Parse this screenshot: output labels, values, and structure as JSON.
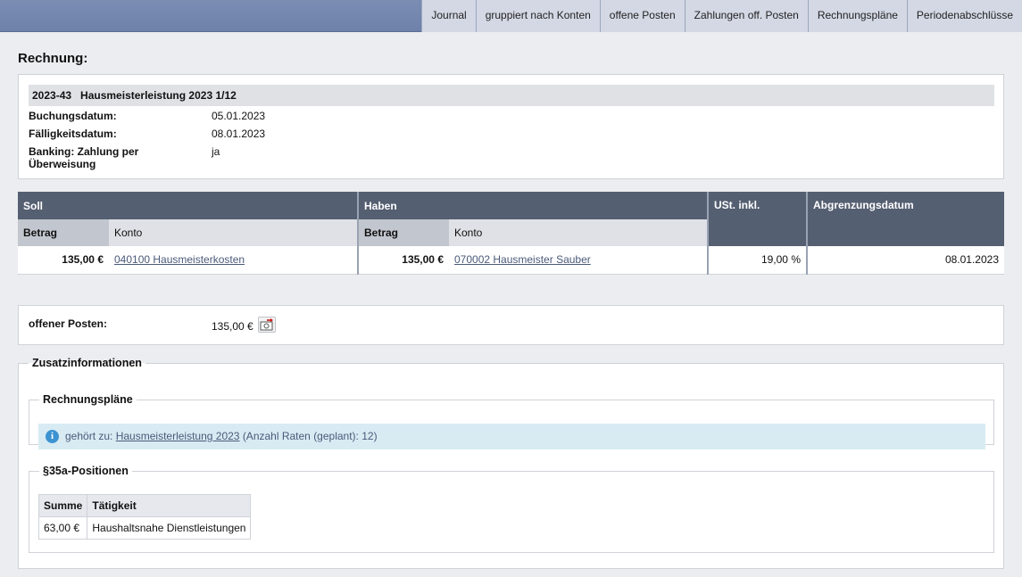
{
  "nav": {
    "tabs": [
      "Journal",
      "gruppiert nach Konten",
      "offene Posten",
      "Zahlungen off. Posten",
      "Rechnungspläne",
      "Periodenabschlüsse"
    ]
  },
  "page": {
    "title": "Rechnung:"
  },
  "invoice": {
    "number": "2023-43",
    "name": "Hausmeisterleistung 2023 1/12",
    "booking_date_label": "Buchungsdatum:",
    "booking_date": "05.01.2023",
    "due_date_label": "Fälligkeitsdatum:",
    "due_date": "08.01.2023",
    "banking_label": "Banking: Zahlung per Überweisung",
    "banking_value": "ja"
  },
  "booking": {
    "soll_header": "Soll",
    "haben_header": "Haben",
    "ust_header": "USt. inkl.",
    "abgrenzung_header": "Abgrenzungsdatum",
    "betrag_label": "Betrag",
    "konto_label": "Konto",
    "row": {
      "soll_betrag": "135,00 €",
      "soll_konto": "040100 Hausmeisterkosten",
      "haben_betrag": "135,00 €",
      "haben_konto": "070002 Hausmeister Sauber",
      "ust": "19,00 %",
      "abgrenzung": "08.01.2023"
    }
  },
  "open_item": {
    "label": "offener Posten:",
    "value": "135,00 €",
    "icon": "payment-icon"
  },
  "extra": {
    "legend": "Zusatzinformationen",
    "plans": {
      "legend": "Rechnungspläne",
      "prefix": "gehört zu:",
      "link": "Hausmeisterleistung 2023",
      "suffix": "(Anzahl Raten (geplant): 12)"
    },
    "positions": {
      "legend": "§35a-Positionen",
      "headers": [
        "Summe",
        "Tätigkeit"
      ],
      "rows": [
        [
          "63,00 €",
          "Haushaltsnahe Dienstleistungen"
        ]
      ]
    }
  }
}
